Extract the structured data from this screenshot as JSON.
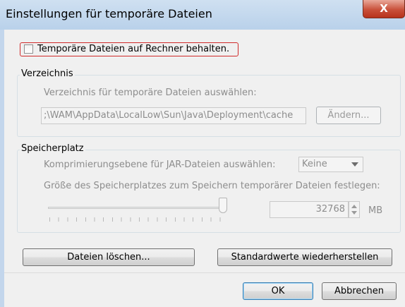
{
  "window": {
    "title": "Einstellungen für temporäre Dateien",
    "close_label": "X"
  },
  "keep_temp": {
    "label": "Temporäre Dateien auf Rechner behalten.",
    "checked": false
  },
  "directory": {
    "group_title": "Verzeichnis",
    "prompt": "Verzeichnis für temporäre Dateien auswählen:",
    "path": ";\\WAM\\AppData\\LocalLow\\Sun\\Java\\Deployment\\cache",
    "change_label": "Ändern..."
  },
  "storage": {
    "group_title": "Speicherplatz",
    "compression_prompt": "Komprimierungsebene für JAR-Dateien auswählen:",
    "compression_value": "Keine",
    "size_prompt": "Größe des Speicherplatzes zum Speichern temporärer Dateien festlegen:",
    "size_value": "32768",
    "size_unit": "MB",
    "slider_level": 1.0
  },
  "actions": {
    "delete_label": "Dateien löschen...",
    "restore_label": "Standardwerte wiederherstellen"
  },
  "footer": {
    "ok_label": "OK",
    "cancel_label": "Abbrechen"
  },
  "colors": {
    "focus_border": "#d02a2a",
    "titlebar": "#c4d9ef",
    "close_button": "#c9503a"
  }
}
